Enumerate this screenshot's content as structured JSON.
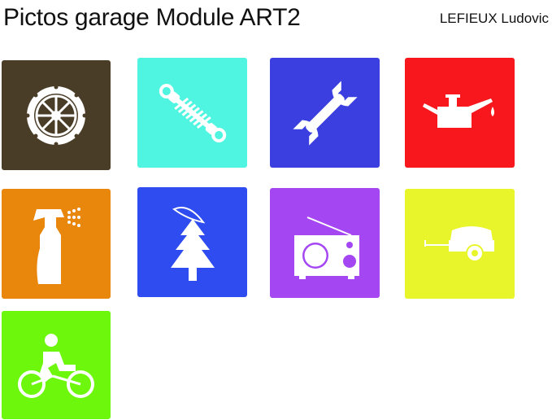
{
  "title": "Pictos garage Module ART2",
  "author": "LEFIEUX Ludovic",
  "tiles": [
    {
      "id": "t-wheel",
      "icon": "wheel-icon",
      "color": "#4a3d28"
    },
    {
      "id": "t-shock",
      "icon": "shock-absorber-icon",
      "color": "#4ff5e0"
    },
    {
      "id": "t-wrench",
      "icon": "wrench-icon",
      "color": "#3b3fe0"
    },
    {
      "id": "t-oil",
      "icon": "oil-can-icon",
      "color": "#f7171c"
    },
    {
      "id": "t-spray",
      "icon": "spray-bottle-icon",
      "color": "#e8870c"
    },
    {
      "id": "t-tree",
      "icon": "tree-air-freshener-icon",
      "color": "#2e4cf0"
    },
    {
      "id": "t-radio",
      "icon": "radio-icon",
      "color": "#a446f2"
    },
    {
      "id": "t-trailer",
      "icon": "trailer-icon",
      "color": "#e8f52a"
    },
    {
      "id": "t-bike",
      "icon": "bicycle-icon",
      "color": "#6cf70c"
    }
  ]
}
